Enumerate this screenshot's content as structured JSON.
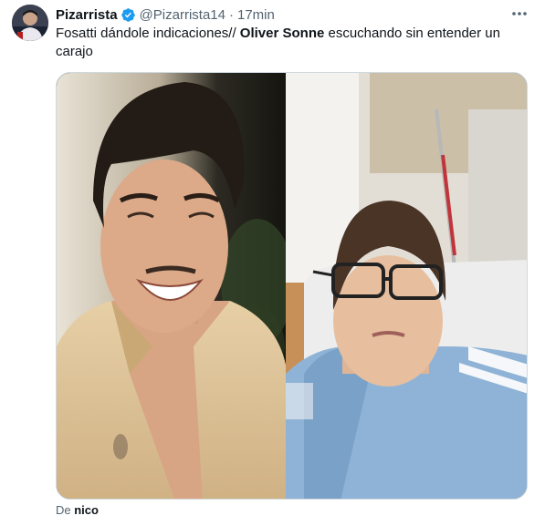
{
  "tweet": {
    "display_name": "Pizarrista",
    "handle": "@Pizarrista14",
    "separator": "·",
    "time": "17min",
    "text_before": "Fosatti dándole indicaciones// ",
    "text_bold": "Oliver Sonne",
    "text_after": " escuchando sin entender un carajo",
    "attribution_prefix": "De ",
    "attribution_name": "nico"
  },
  "colors": {
    "verified": "#1d9bf0",
    "secondary_text": "#536471",
    "primary_text": "#0f1419"
  },
  "icons": {
    "verified": "verified-badge-icon",
    "more": "more-horizontal-icon"
  }
}
